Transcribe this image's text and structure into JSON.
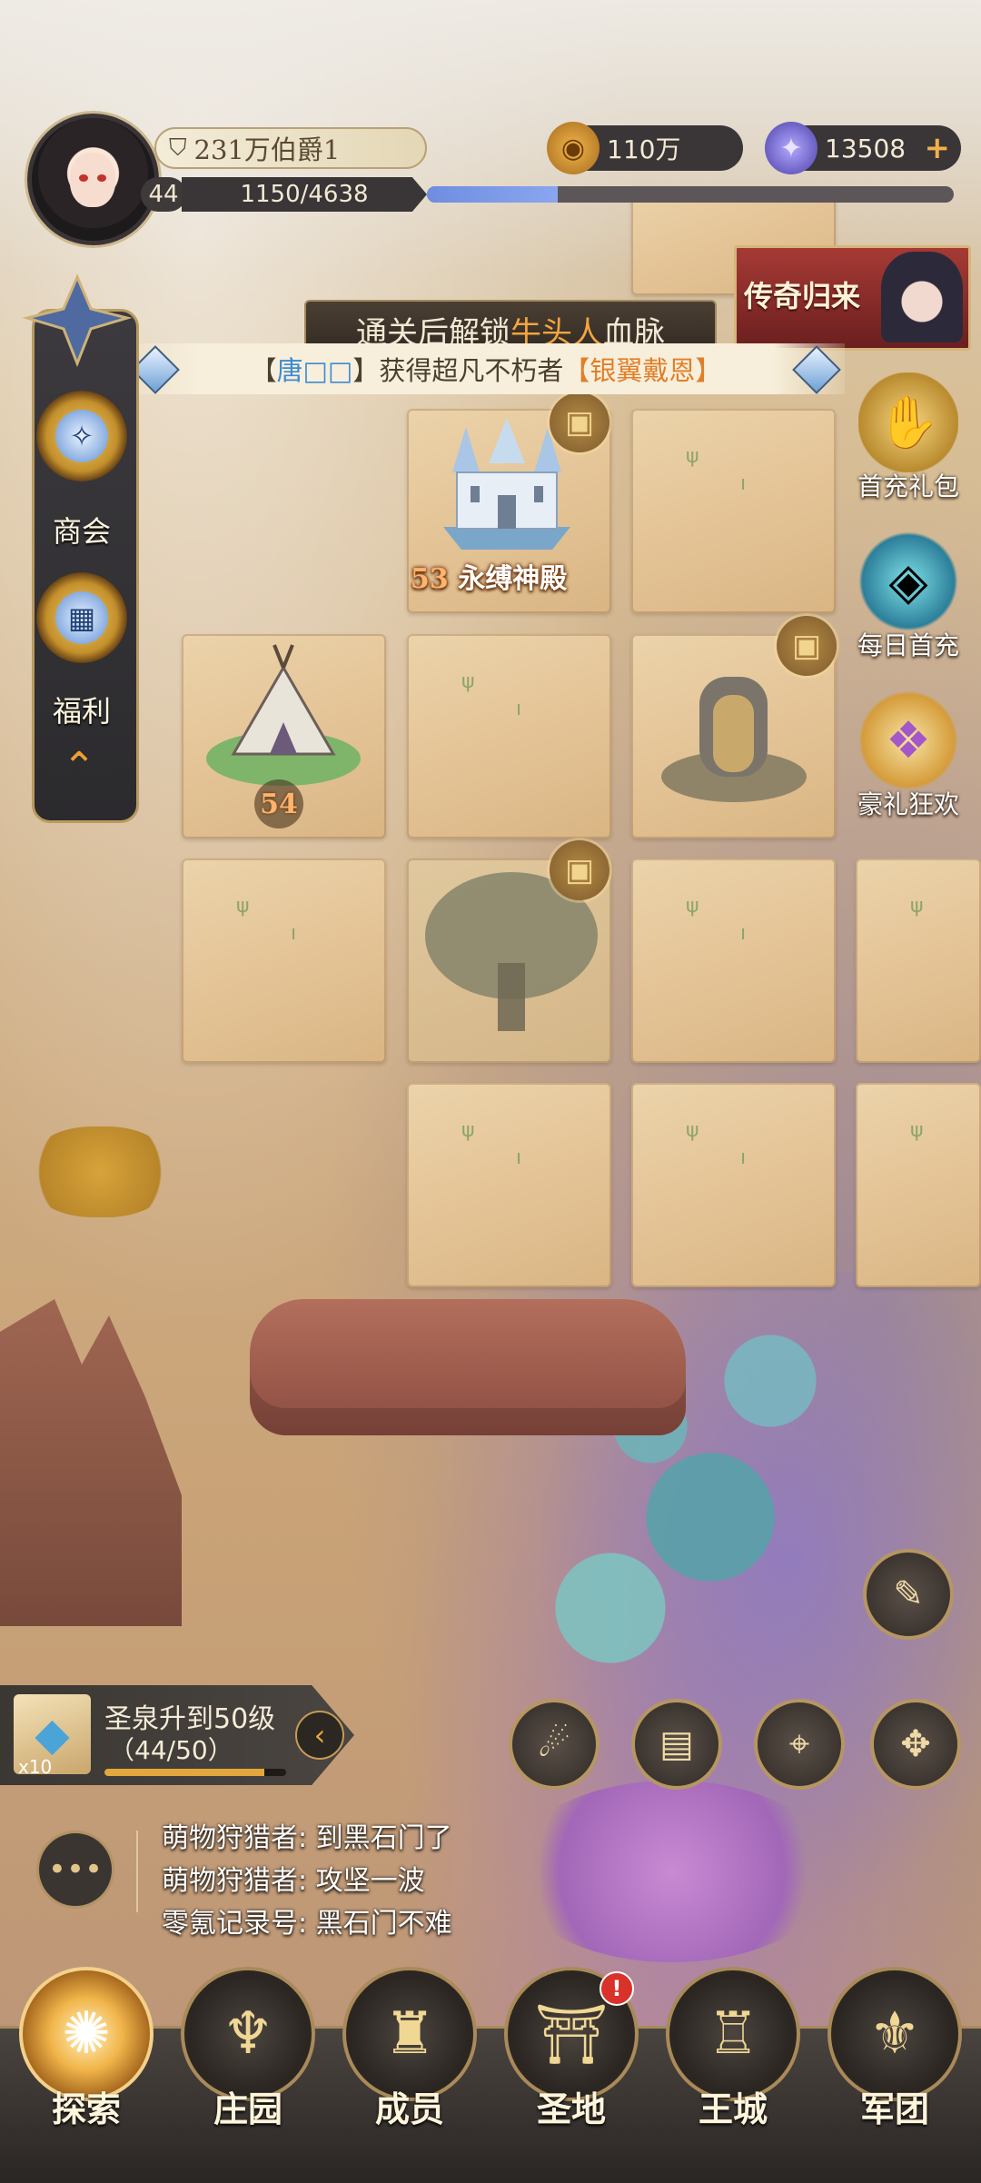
{
  "header": {
    "rank_title": "231万伯爵1",
    "level": "44",
    "exp_text": "1150/4638",
    "exp_fraction": 0.248,
    "gold": "110万",
    "gems": "13508",
    "plus_icon": "plus-icon"
  },
  "banner": {
    "unlock_prefix": "通关后解锁",
    "unlock_highlight": "牛头人",
    "unlock_suffix": "血脉",
    "notice_left_bracket": "【",
    "notice_player": "唐□□",
    "notice_right_bracket": "】",
    "notice_middle": "获得超凡不朽者",
    "notice_hero": "【银翼戴恩】",
    "legend_event": "传奇归来"
  },
  "left_menu": {
    "shop_label": "商会",
    "welfare_label": "福利"
  },
  "right_menu": {
    "first_recharge": "首充礼包",
    "daily_first": "每日首充",
    "gift_carnival": "豪礼狂欢"
  },
  "map": {
    "temple_level": "53",
    "temple_name": "永缚神殿",
    "tent_level": "54"
  },
  "quest": {
    "title": "圣泉升到50级",
    "progress_text": "（44/50）",
    "progress_fraction": 0.88,
    "reward_count": "x10"
  },
  "chat": {
    "lines": [
      "萌物狩猎者: 到黑石门了",
      "萌物狩猎者: 攻坚一波",
      "零氪记录号: 黑石门不难"
    ]
  },
  "nav": {
    "explore": "探索",
    "manor": "庄园",
    "members": "成员",
    "holy_land": "圣地",
    "royal_city": "王城",
    "legion": "军团",
    "holy_land_badge": "!"
  }
}
